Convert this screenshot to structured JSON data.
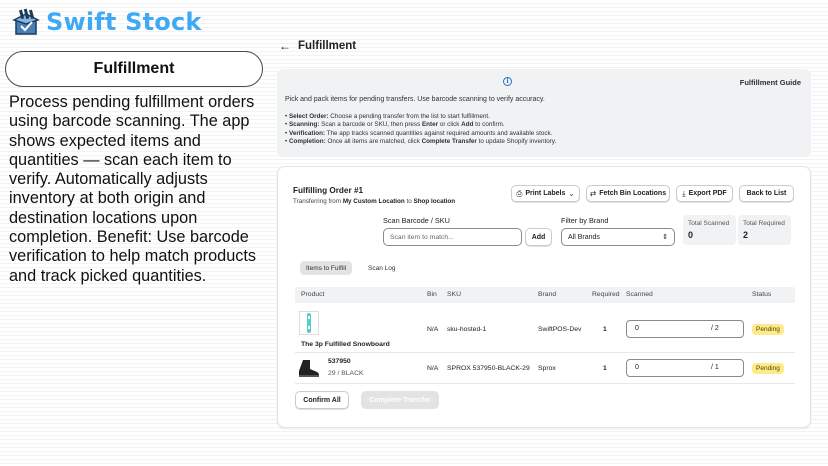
{
  "brand": {
    "name": "Swift Stock",
    "accent": "#3fa9f5"
  },
  "feature": {
    "title": "Fulfillment",
    "description": "Process pending fulfillment orders using barcode scanning. The app shows expected items and quantities — scan each item to verify. Automatically adjusts inventory at both origin and destination locations upon completion. Benefit: Use barcode verification to help match products and track picked quantities."
  },
  "page": {
    "back_icon": "←",
    "title": "Fulfillment"
  },
  "guide": {
    "title": "Fulfillment Guide",
    "info_icon": "i",
    "intro": "Pick and pack items for pending transfers. Use barcode scanning to verify accuracy.",
    "steps": [
      {
        "label": "Select Order:",
        "p1": " Choose a pending transfer from the list to start fulfillment.",
        "k1": "",
        "p2": "",
        "k2": "",
        "p3": ""
      },
      {
        "label": "Scanning:",
        "p1": " Scan a barcode or SKU, then press ",
        "k1": "Enter",
        "p2": " or click ",
        "k2": "Add",
        "p3": " to confirm."
      },
      {
        "label": "Verification:",
        "p1": " The app tracks scanned quantities against required amounts and available stock.",
        "k1": "",
        "p2": "",
        "k2": "",
        "p3": ""
      },
      {
        "label": "Completion:",
        "p1": " Once all items are matched, click ",
        "k1": "Complete Transfer",
        "p2": " to update Shopify inventory.",
        "k2": "",
        "p3": ""
      }
    ]
  },
  "order": {
    "title": "Fulfilling Order #1",
    "sub_prefix": "Transferring from ",
    "origin": "My Custom Location",
    "sub_mid": " to ",
    "destination": "Shop location"
  },
  "actions": {
    "print_labels": "Print Labels",
    "fetch_bin": "Fetch Bin Locations",
    "export_pdf": "Export PDF",
    "back_to_list": "Back to List"
  },
  "scan": {
    "label": "Scan Barcode / SKU",
    "placeholder": "Scan item to match...",
    "add": "Add"
  },
  "filter": {
    "label": "Filter by Brand",
    "value": "All Brands"
  },
  "stats": {
    "scanned_label": "Total Scanned",
    "scanned_value": "0",
    "required_label": "Total Required",
    "required_value": "2"
  },
  "tabs": [
    "Items to Fulfill",
    "Scan Log"
  ],
  "table": {
    "headers": [
      "Product",
      "Bin",
      "SKU",
      "Brand",
      "Required",
      "Scanned",
      "Status"
    ],
    "rows": [
      {
        "product": "The 3p Fulfilled Snowboard",
        "variant": "",
        "bin": "N/A",
        "sku": "sku-hosted-1",
        "brand": "SwiftPOS-Dev",
        "required": "1",
        "scanned": "0",
        "scanned_of": "/ 2",
        "status": "Pending"
      },
      {
        "product": "537950",
        "variant": "29 / BLACK",
        "bin": "N/A",
        "sku": "SPROX 537950-BLACK-29",
        "brand": "Sprox",
        "required": "1",
        "scanned": "0",
        "scanned_of": "/ 1",
        "status": "Pending"
      }
    ]
  },
  "footer": {
    "confirm_all": "Confirm All",
    "complete_transfer": "Complete Transfer"
  },
  "colors": {
    "pending_badge": "#ffea8a",
    "info": "#2c6ecb"
  }
}
